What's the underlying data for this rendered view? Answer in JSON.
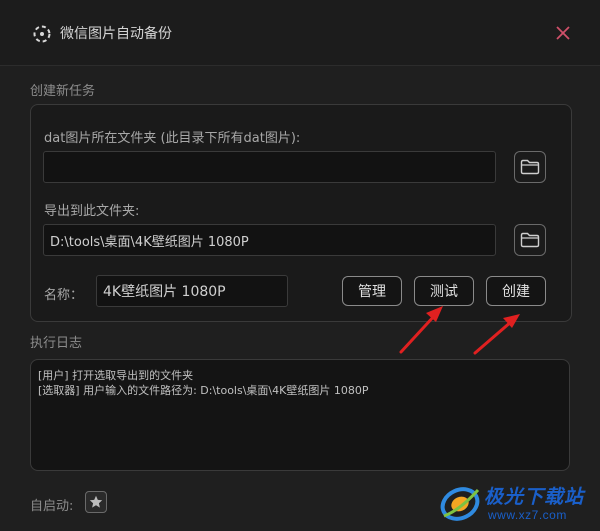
{
  "window": {
    "title": "微信图片自动备份",
    "close_icon": "close-icon",
    "app_icon": "dashed-circle-icon"
  },
  "create_task": {
    "section_title": "创建新任务",
    "source": {
      "label": "dat图片所在文件夹 (此目录下所有dat图片):",
      "value": ""
    },
    "export": {
      "label": "导出到此文件夹:",
      "value": "D:\\tools\\桌面\\4K壁纸图片 1080P"
    },
    "name": {
      "label": "名称：",
      "value": "4K壁纸图片 1080P"
    },
    "buttons": {
      "manage": "管理",
      "test": "测试",
      "create": "创建"
    }
  },
  "log": {
    "section_title": "执行日志",
    "lines": [
      "[用户] 打开选取导出到的文件夹",
      "[选取器] 用户输入的文件路径为: D:\\tools\\桌面\\4K壁纸图片 1080P"
    ]
  },
  "autostart": {
    "label": "自启动:",
    "icon": "star-icon"
  },
  "watermark": {
    "title": "极光下载站",
    "url": "www.xz7.com"
  },
  "colors": {
    "background": "#1f1f1f",
    "close": "#d0506a",
    "arrow": "#e02020",
    "watermark_blue": "#1a5fc9"
  }
}
